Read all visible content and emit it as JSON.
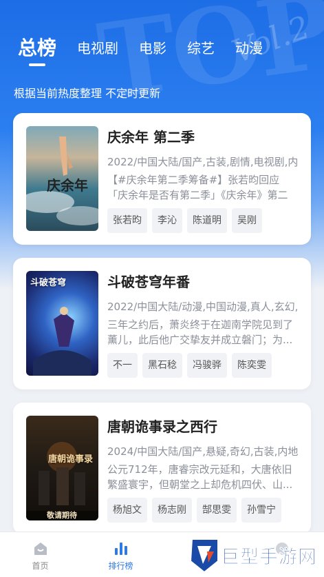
{
  "tabs": [
    {
      "label": "总榜"
    },
    {
      "label": "电视剧"
    },
    {
      "label": "电影"
    },
    {
      "label": "综艺"
    },
    {
      "label": "动漫"
    }
  ],
  "subtitle": "根据当前热度整理 不定时更新",
  "cards": [
    {
      "title": "庆余年 第二季",
      "meta": "2022/中国大陆/国产,古装,剧情,电视剧,内",
      "desc": "【#庆余年第二季筹备#】张若昀回应「庆余年是否有第二季」《庆余年》第二季...",
      "actors": [
        "张若昀",
        "李沁",
        "陈道明",
        "吴刚"
      ],
      "poster_text": "庆余年"
    },
    {
      "title": "斗破苍穹年番",
      "meta": "2022/中国大陆/动漫,中国动漫,真人,玄幻,",
      "desc": "三年之约后，萧炎终于在迦南学院见到了薰儿，此后他广交挚友并成立磐门；为...",
      "actors": [
        "不一",
        "黑石稔",
        "冯骏骅",
        "陈奕雯"
      ],
      "poster_text": "斗破苍穹"
    },
    {
      "title": "唐朝诡事录之西行",
      "meta": "2024/中国大陆/国产,悬疑,奇幻,古装,内地",
      "desc": "公元712年，唐睿宗改元延和，大唐依旧繁盛寰宇，但朝堂之上却危机四伏、山...",
      "actors": [
        "杨旭文",
        "杨志刚",
        "郜思雯",
        "孙雪宁"
      ],
      "poster_text": "唐朝诡事录",
      "poster_caption": "敬请期待"
    }
  ],
  "nav": [
    {
      "label": "首页",
      "icon": "home-icon"
    },
    {
      "label": "排行榜",
      "icon": "rank-icon"
    }
  ],
  "watermark": {
    "text": "巨型手游网"
  },
  "colors": {
    "accent": "#2c79e8",
    "hero": "#1d6de6"
  }
}
